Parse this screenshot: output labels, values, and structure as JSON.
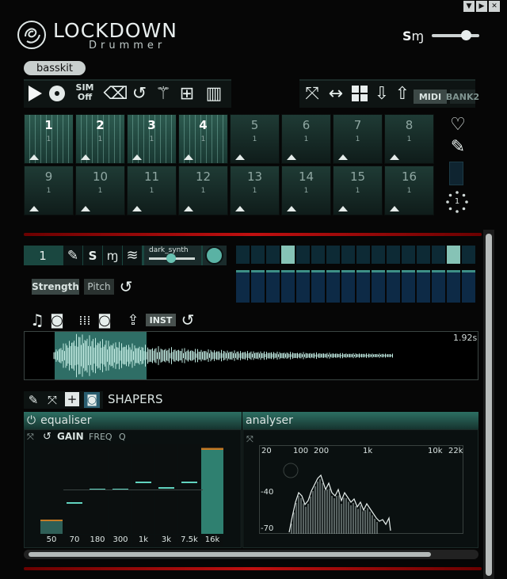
{
  "app": {
    "brand": "LOCKDOWN",
    "brand_sub": "Drummer",
    "sm_label": "S",
    "volume_level": 0.72
  },
  "kit_name": "basskit",
  "toolbar": {
    "sim_label_top": "SIM",
    "sim_label_bottom": "Off",
    "midi_label": "MIDI",
    "bank_label": "BANK2"
  },
  "pads": [
    {
      "num": "1",
      "sub": "1",
      "active": true
    },
    {
      "num": "2",
      "sub": "1",
      "active": true
    },
    {
      "num": "3",
      "sub": "1",
      "active": true
    },
    {
      "num": "4",
      "sub": "1",
      "active": true
    },
    {
      "num": "5",
      "sub": "1",
      "active": false
    },
    {
      "num": "6",
      "sub": "1",
      "active": false
    },
    {
      "num": "7",
      "sub": "1",
      "active": false
    },
    {
      "num": "8",
      "sub": "1",
      "active": false
    },
    {
      "num": "9",
      "sub": "1",
      "active": false
    },
    {
      "num": "10",
      "sub": "1",
      "active": false
    },
    {
      "num": "11",
      "sub": "1",
      "active": false
    },
    {
      "num": "12",
      "sub": "1",
      "active": false
    },
    {
      "num": "13",
      "sub": "1",
      "active": false
    },
    {
      "num": "14",
      "sub": "1",
      "active": false
    },
    {
      "num": "15",
      "sub": "1",
      "active": false
    },
    {
      "num": "16",
      "sub": "1",
      "active": false
    }
  ],
  "side": {
    "counter": "1"
  },
  "track": {
    "number": "1",
    "s_label": "S",
    "preset": "dark_synth",
    "strength_label": "Strength",
    "pitch_label": "Pitch",
    "steps_on": [
      3,
      14
    ]
  },
  "sample": {
    "inst_label": "INST",
    "duration": "1.92s"
  },
  "shapers": {
    "title": "SHAPERS",
    "equaliser_title": "equaliser",
    "analyser_title": "analyser",
    "gain_label": "GAIN",
    "freq_label": "FREQ",
    "q_label": "Q",
    "eq_bands": [
      "50",
      "70",
      "180",
      "300",
      "1k",
      "3k",
      "7.5k",
      "16k"
    ],
    "analyser_freq_labels": [
      "20",
      "100",
      "200",
      "1k",
      "10k",
      "22k"
    ],
    "analyser_db_labels": [
      "-40",
      "-70"
    ]
  },
  "colors": {
    "accent": "#2f6e66",
    "step_on": "#86c3b6",
    "divider": "#c01010"
  }
}
